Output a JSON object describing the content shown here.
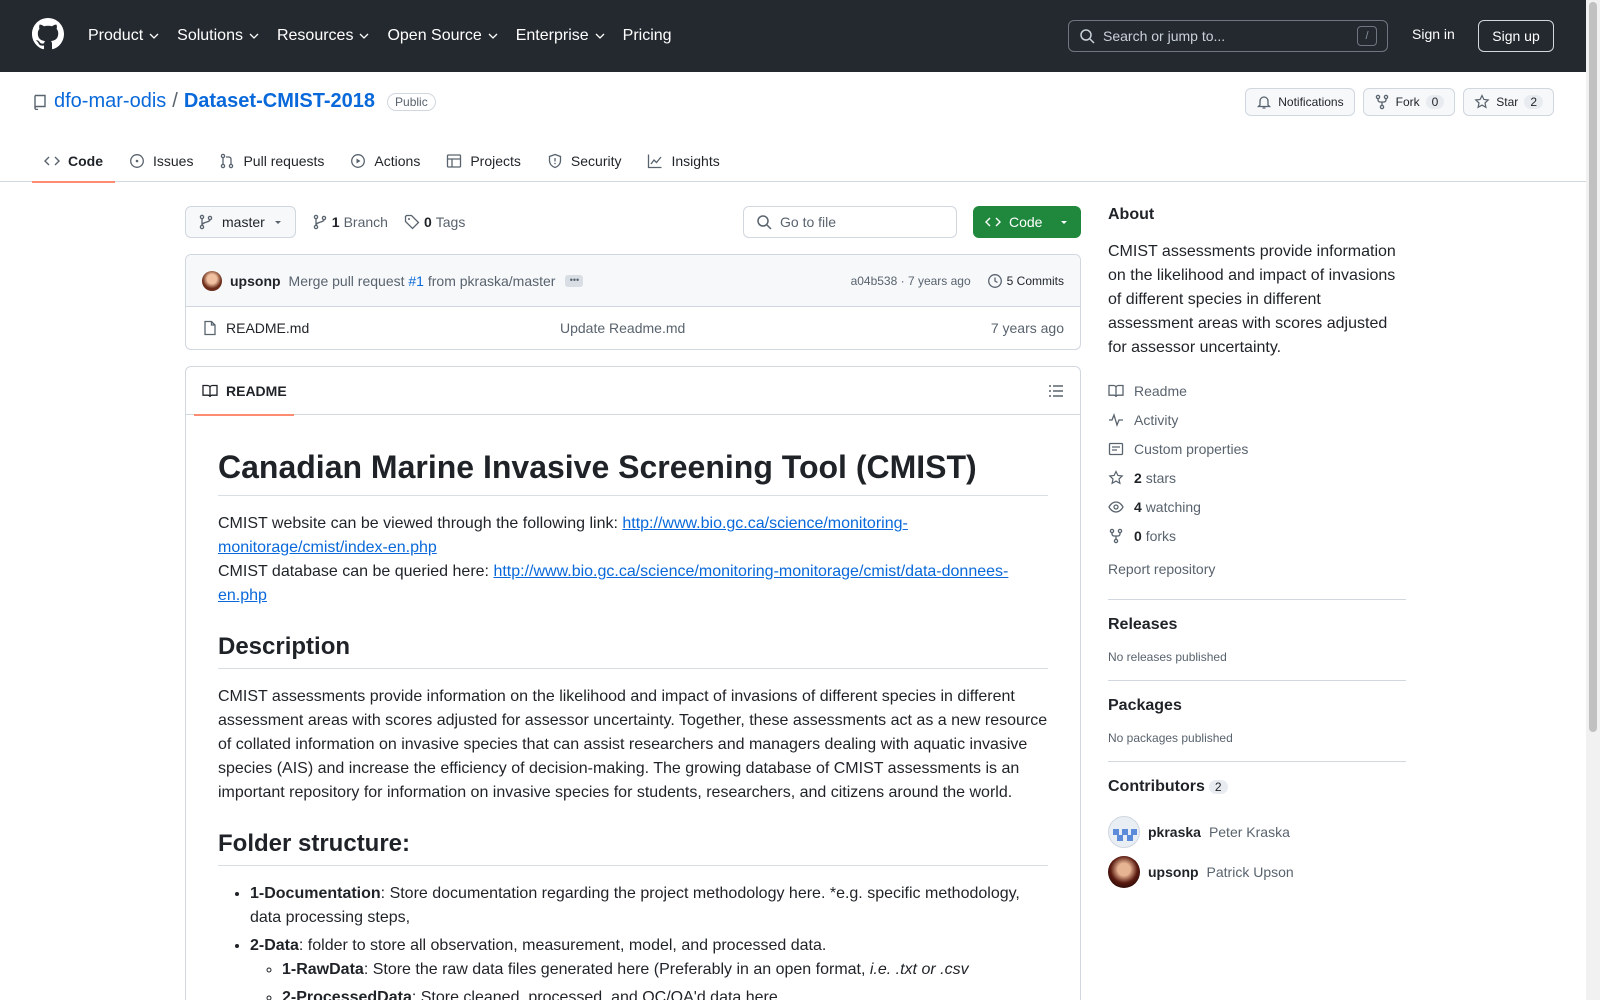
{
  "header": {
    "nav": [
      "Product",
      "Solutions",
      "Resources",
      "Open Source",
      "Enterprise",
      "Pricing"
    ],
    "search_placeholder": "Search or jump to...",
    "search_shortcut": "/",
    "signin": "Sign in",
    "signup": "Sign up"
  },
  "repo": {
    "owner": "dfo-mar-odis",
    "separator": "/",
    "name": "Dataset-CMIST-2018",
    "visibility": "Public",
    "notifications": "Notifications",
    "fork_label": "Fork",
    "fork_count": "0",
    "star_label": "Star",
    "star_count": "2",
    "tabs": [
      "Code",
      "Issues",
      "Pull requests",
      "Actions",
      "Projects",
      "Security",
      "Insights"
    ]
  },
  "toolbar": {
    "branch": "master",
    "branch_count": "1",
    "branch_label": "Branch",
    "tag_count": "0",
    "tag_label": "Tags",
    "goto_placeholder": "Go to file",
    "code_label": "Code"
  },
  "commit": {
    "author": "upsonp",
    "message_prefix": "Merge pull request",
    "pr": "#1",
    "message_suffix": "from pkraska/master",
    "meta": "a04b538 · 7 years ago",
    "commits": "5 Commits"
  },
  "files": [
    {
      "name": "README.md",
      "message": "Update Readme.md",
      "age": "7 years ago"
    }
  ],
  "readme": {
    "tab_label": "README",
    "h1": "Canadian Marine Invasive Screening Tool (CMIST)",
    "website_text": "CMIST website can be viewed through the following link: ",
    "website_url": "http://www.bio.gc.ca/science/monitoring-monitorage/cmist/index-en.php",
    "db_text": "CMIST database can be queried here: ",
    "db_url": "http://www.bio.gc.ca/science/monitoring-monitorage/cmist/data-donnees-en.php",
    "h2_description": "Description",
    "description": "CMIST assessments provide information on the likelihood and impact of invasions of different species in different assessment areas with scores adjusted for assessor uncertainty. Together, these assessments act as a new resource of collated information on invasive species that can assist researchers and managers dealing with aquatic invasive species (AIS) and increase the efficiency of decision-making. The growing database of CMIST assessments is an important repository for information on invasive species for students, researchers, and citizens around the world.",
    "h2_folders": "Folder structure:",
    "folders": [
      {
        "name": "1-Documentation",
        "text": ": Store documentation regarding the project methodology here. *e.g. specific methodology, data processing steps,"
      },
      {
        "name": "2-Data",
        "text": ": folder to store all observation, measurement, model, and processed data."
      }
    ],
    "subfolders": [
      {
        "name": "1-RawData",
        "text": ": Store the raw data files generated here (Preferably in an open format, ",
        "italic": "i.e. .txt or .csv"
      },
      {
        "name": "2-ProcessedData",
        "text": ": Store cleaned, processed, and QC/QA'd data here"
      }
    ]
  },
  "sidebar": {
    "about_title": "About",
    "about_desc": "CMIST assessments provide information on the likelihood and impact of invasions of different species in different assessment areas with scores adjusted for assessor uncertainty.",
    "links": {
      "readme": "Readme",
      "activity": "Activity",
      "custom": "Custom properties",
      "stars_count": "2",
      "stars_label": "stars",
      "watching_count": "4",
      "watching_label": "watching",
      "forks_count": "0",
      "forks_label": "forks"
    },
    "report": "Report repository",
    "releases_title": "Releases",
    "releases_sub": "No releases published",
    "packages_title": "Packages",
    "packages_sub": "No packages published",
    "contributors_title": "Contributors",
    "contributors_count": "2",
    "contributors": [
      {
        "login": "pkraska",
        "name": "Peter Kraska"
      },
      {
        "login": "upsonp",
        "name": "Patrick Upson"
      }
    ]
  }
}
